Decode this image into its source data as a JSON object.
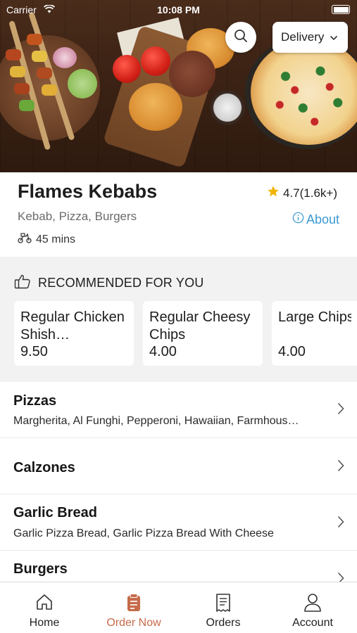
{
  "status_bar": {
    "carrier": "Carrier",
    "time": "10:08 PM"
  },
  "header": {
    "delivery_label": "Delivery",
    "search_icon": "search-icon"
  },
  "restaurant": {
    "name": "Flames Kebabs",
    "rating": "4.7(1.6k+)",
    "cuisines": "Kebab, Pizza, Burgers",
    "about_label": "About",
    "delivery_time": "45 mins"
  },
  "recommended": {
    "title": "RECOMMENDED FOR YOU",
    "items": [
      {
        "name": "Regular Chicken Shish…",
        "price": "9.50"
      },
      {
        "name": "Regular Cheesy Chips",
        "price": "4.00"
      },
      {
        "name": "Large Chips",
        "price": "4.00"
      }
    ]
  },
  "categories": [
    {
      "title": "Pizzas",
      "description": "Margherita, Al Funghi, Pepperoni, Hawaiian, Farmhous…"
    },
    {
      "title": "Calzones",
      "description": ""
    },
    {
      "title": "Garlic Bread",
      "description": "Garlic Pizza Bread, Garlic Pizza Bread With Cheese"
    },
    {
      "title": "Burgers",
      "description": ""
    }
  ],
  "tabbar": {
    "items": [
      {
        "label": "Home",
        "icon": "home-icon"
      },
      {
        "label": "Order Now",
        "icon": "order-icon"
      },
      {
        "label": "Orders",
        "icon": "receipt-icon"
      },
      {
        "label": "Account",
        "icon": "user-icon"
      }
    ],
    "active": "Order Now"
  },
  "colors": {
    "accent": "#c66b4a",
    "link": "#3b9ad3",
    "star": "#f0b400",
    "section_bg": "#f2f2f2"
  }
}
